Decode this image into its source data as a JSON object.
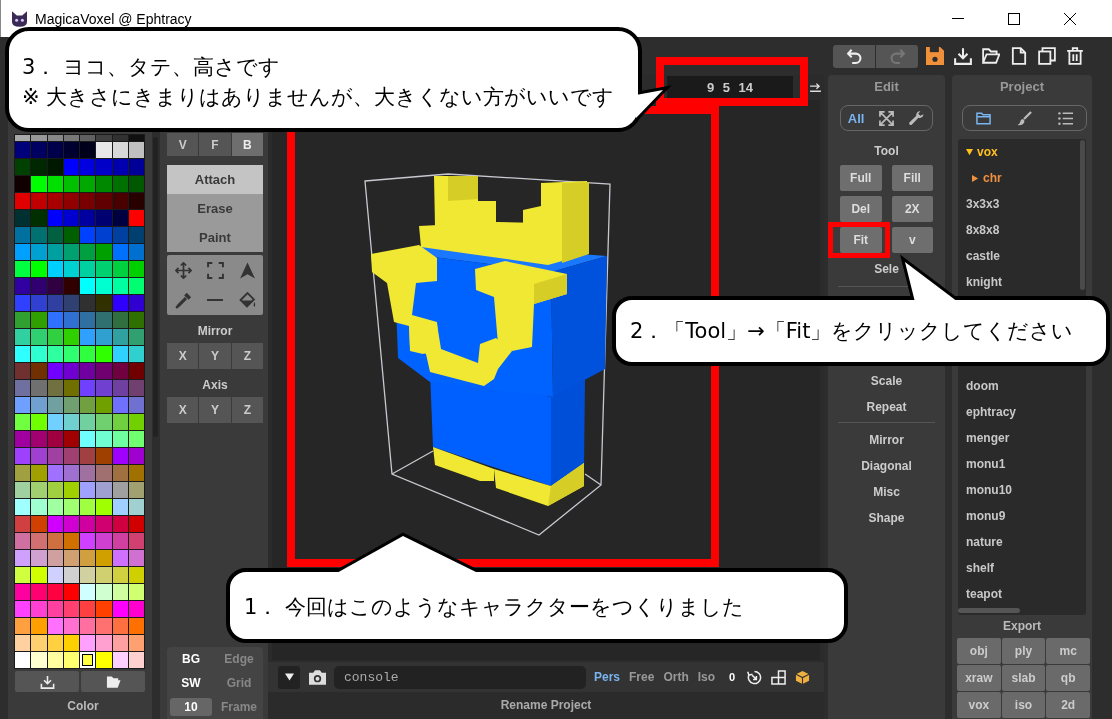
{
  "window": {
    "title": "MagicaVoxel @ Ephtracy"
  },
  "toolbar": {
    "history": [
      {
        "disabled": false
      },
      {
        "disabled": true
      }
    ]
  },
  "palette": {
    "label": "Color",
    "swatches": [
      {
        "color": "#a8a8a8",
        "selected": false
      },
      {
        "color": "#989898",
        "selected": false
      },
      {
        "color": "#888888",
        "selected": false
      },
      {
        "color": "#787878",
        "selected": false
      },
      {
        "color": "#606060",
        "selected": false
      },
      {
        "color": "#404040",
        "selected": false
      },
      {
        "color": "#303030",
        "selected": false
      },
      {
        "color": "#101010",
        "selected": false
      },
      {
        "color": "#00007a",
        "selected": false
      },
      {
        "color": "#000060",
        "selected": false
      },
      {
        "color": "#00004a",
        "selected": false
      },
      {
        "color": "#000030",
        "selected": false
      },
      {
        "color": "#00001a",
        "selected": false
      },
      {
        "color": "#e8e8e8",
        "selected": false
      },
      {
        "color": "#d8d8d8",
        "selected": false
      },
      {
        "color": "#c0c0c0",
        "selected": false
      },
      {
        "color": "#004000",
        "selected": false
      },
      {
        "color": "#002800",
        "selected": false
      },
      {
        "color": "#001800",
        "selected": false
      },
      {
        "color": "#0000ff",
        "selected": false
      },
      {
        "color": "#0000e0",
        "selected": false
      },
      {
        "color": "#0000c8",
        "selected": false
      },
      {
        "color": "#0000b0",
        "selected": false
      },
      {
        "color": "#000098",
        "selected": false
      },
      {
        "color": "#100000",
        "selected": false
      },
      {
        "color": "#00ff00",
        "selected": false
      },
      {
        "color": "#00e000",
        "selected": false
      },
      {
        "color": "#00c000",
        "selected": false
      },
      {
        "color": "#00a800",
        "selected": false
      },
      {
        "color": "#008800",
        "selected": false
      },
      {
        "color": "#007000",
        "selected": false
      },
      {
        "color": "#005800",
        "selected": false
      },
      {
        "color": "#e00000",
        "selected": false
      },
      {
        "color": "#c00000",
        "selected": false
      },
      {
        "color": "#a80000",
        "selected": false
      },
      {
        "color": "#900000",
        "selected": false
      },
      {
        "color": "#780000",
        "selected": false
      },
      {
        "color": "#600000",
        "selected": false
      },
      {
        "color": "#480000",
        "selected": false
      },
      {
        "color": "#280000",
        "selected": false
      },
      {
        "color": "#003030",
        "selected": false
      },
      {
        "color": "#003000",
        "selected": false
      },
      {
        "color": "#0000ff",
        "selected": false
      },
      {
        "color": "#0000d0",
        "selected": false
      },
      {
        "color": "#0000a0",
        "selected": false
      },
      {
        "color": "#000070",
        "selected": false
      },
      {
        "color": "#000040",
        "selected": false
      },
      {
        "color": "#ff0000",
        "selected": false
      },
      {
        "color": "#0070a0",
        "selected": false
      },
      {
        "color": "#007070",
        "selected": false
      },
      {
        "color": "#006040",
        "selected": false
      },
      {
        "color": "#006000",
        "selected": false
      },
      {
        "color": "#0040ff",
        "selected": false
      },
      {
        "color": "#0040d0",
        "selected": false
      },
      {
        "color": "#0040a0",
        "selected": false
      },
      {
        "color": "#004070",
        "selected": false
      },
      {
        "color": "#00a0ff",
        "selected": false
      },
      {
        "color": "#00a0d0",
        "selected": false
      },
      {
        "color": "#00a0a0",
        "selected": false
      },
      {
        "color": "#00a070",
        "selected": false
      },
      {
        "color": "#00a040",
        "selected": false
      },
      {
        "color": "#00a000",
        "selected": false
      },
      {
        "color": "#0070ff",
        "selected": false
      },
      {
        "color": "#0070d0",
        "selected": false
      },
      {
        "color": "#00ff40",
        "selected": false
      },
      {
        "color": "#00ff00",
        "selected": false
      },
      {
        "color": "#00d0ff",
        "selected": false
      },
      {
        "color": "#00d0d0",
        "selected": false
      },
      {
        "color": "#00d0a0",
        "selected": false
      },
      {
        "color": "#00d070",
        "selected": false
      },
      {
        "color": "#00d040",
        "selected": false
      },
      {
        "color": "#00d000",
        "selected": false
      },
      {
        "color": "#3000a0",
        "selected": false
      },
      {
        "color": "#300070",
        "selected": false
      },
      {
        "color": "#300040",
        "selected": false
      },
      {
        "color": "#300000",
        "selected": false
      },
      {
        "color": "#00ffff",
        "selected": false
      },
      {
        "color": "#00ffd0",
        "selected": false
      },
      {
        "color": "#00ffa0",
        "selected": false
      },
      {
        "color": "#00ff70",
        "selected": false
      },
      {
        "color": "#3040ff",
        "selected": false
      },
      {
        "color": "#3040d0",
        "selected": false
      },
      {
        "color": "#3040a0",
        "selected": false
      },
      {
        "color": "#304070",
        "selected": false
      },
      {
        "color": "#303030",
        "selected": false
      },
      {
        "color": "#303000",
        "selected": false
      },
      {
        "color": "#3000ff",
        "selected": false
      },
      {
        "color": "#3000d0",
        "selected": false
      },
      {
        "color": "#30a030",
        "selected": false
      },
      {
        "color": "#30a000",
        "selected": false
      },
      {
        "color": "#3070ff",
        "selected": false
      },
      {
        "color": "#3070d0",
        "selected": false
      },
      {
        "color": "#3070a0",
        "selected": false
      },
      {
        "color": "#307070",
        "selected": false
      },
      {
        "color": "#307040",
        "selected": false
      },
      {
        "color": "#307000",
        "selected": false
      },
      {
        "color": "#30d0a0",
        "selected": false
      },
      {
        "color": "#30d070",
        "selected": false
      },
      {
        "color": "#30d040",
        "selected": false
      },
      {
        "color": "#30d000",
        "selected": false
      },
      {
        "color": "#30a0ff",
        "selected": false
      },
      {
        "color": "#30a0d0",
        "selected": false
      },
      {
        "color": "#30a0a0",
        "selected": false
      },
      {
        "color": "#30a070",
        "selected": false
      },
      {
        "color": "#30ffff",
        "selected": false
      },
      {
        "color": "#30ffd0",
        "selected": false
      },
      {
        "color": "#30ffa0",
        "selected": false
      },
      {
        "color": "#30ff70",
        "selected": false
      },
      {
        "color": "#30ff40",
        "selected": false
      },
      {
        "color": "#30ff00",
        "selected": false
      },
      {
        "color": "#30d0ff",
        "selected": false
      },
      {
        "color": "#30d0d0",
        "selected": false
      },
      {
        "color": "#703030",
        "selected": false
      },
      {
        "color": "#703000",
        "selected": false
      },
      {
        "color": "#7000ff",
        "selected": false
      },
      {
        "color": "#7000d0",
        "selected": false
      },
      {
        "color": "#7000a0",
        "selected": false
      },
      {
        "color": "#700070",
        "selected": false
      },
      {
        "color": "#700040",
        "selected": false
      },
      {
        "color": "#700000",
        "selected": false
      },
      {
        "color": "#7070a0",
        "selected": false
      },
      {
        "color": "#707070",
        "selected": false
      },
      {
        "color": "#707040",
        "selected": false
      },
      {
        "color": "#707000",
        "selected": false
      },
      {
        "color": "#7040ff",
        "selected": false
      },
      {
        "color": "#7040d0",
        "selected": false
      },
      {
        "color": "#7040a0",
        "selected": false
      },
      {
        "color": "#704070",
        "selected": false
      },
      {
        "color": "#70a0ff",
        "selected": false
      },
      {
        "color": "#70a0d0",
        "selected": false
      },
      {
        "color": "#70a0a0",
        "selected": false
      },
      {
        "color": "#70a070",
        "selected": false
      },
      {
        "color": "#70a040",
        "selected": false
      },
      {
        "color": "#70a000",
        "selected": false
      },
      {
        "color": "#7070ff",
        "selected": false
      },
      {
        "color": "#7070d0",
        "selected": false
      },
      {
        "color": "#70ff40",
        "selected": false
      },
      {
        "color": "#70ff00",
        "selected": false
      },
      {
        "color": "#70d0ff",
        "selected": false
      },
      {
        "color": "#70d0d0",
        "selected": false
      },
      {
        "color": "#70d0a0",
        "selected": false
      },
      {
        "color": "#70d070",
        "selected": false
      },
      {
        "color": "#70d040",
        "selected": false
      },
      {
        "color": "#70d000",
        "selected": false
      },
      {
        "color": "#a000a0",
        "selected": false
      },
      {
        "color": "#a00070",
        "selected": false
      },
      {
        "color": "#a00040",
        "selected": false
      },
      {
        "color": "#a00000",
        "selected": false
      },
      {
        "color": "#70ffff",
        "selected": false
      },
      {
        "color": "#70ffd0",
        "selected": false
      },
      {
        "color": "#70ffa0",
        "selected": false
      },
      {
        "color": "#70ff70",
        "selected": false
      },
      {
        "color": "#a040ff",
        "selected": false
      },
      {
        "color": "#a040d0",
        "selected": false
      },
      {
        "color": "#a040a0",
        "selected": false
      },
      {
        "color": "#a04070",
        "selected": false
      },
      {
        "color": "#a04040",
        "selected": false
      },
      {
        "color": "#a04000",
        "selected": false
      },
      {
        "color": "#a000ff",
        "selected": false
      },
      {
        "color": "#a000d0",
        "selected": false
      },
      {
        "color": "#a0a040",
        "selected": false
      },
      {
        "color": "#a0a000",
        "selected": false
      },
      {
        "color": "#a070ff",
        "selected": false
      },
      {
        "color": "#a070d0",
        "selected": false
      },
      {
        "color": "#a070a0",
        "selected": false
      },
      {
        "color": "#a07070",
        "selected": false
      },
      {
        "color": "#a07040",
        "selected": false
      },
      {
        "color": "#a07000",
        "selected": false
      },
      {
        "color": "#a0d0a0",
        "selected": false
      },
      {
        "color": "#a0d070",
        "selected": false
      },
      {
        "color": "#a0d040",
        "selected": false
      },
      {
        "color": "#a0d000",
        "selected": false
      },
      {
        "color": "#a0a0ff",
        "selected": false
      },
      {
        "color": "#a0a0d0",
        "selected": false
      },
      {
        "color": "#a0a0a0",
        "selected": false
      },
      {
        "color": "#a0a070",
        "selected": false
      },
      {
        "color": "#a0ffff",
        "selected": false
      },
      {
        "color": "#a0ffd0",
        "selected": false
      },
      {
        "color": "#a0ffa0",
        "selected": false
      },
      {
        "color": "#a0ff70",
        "selected": false
      },
      {
        "color": "#a0ff40",
        "selected": false
      },
      {
        "color": "#a0ff00",
        "selected": false
      },
      {
        "color": "#a0d0ff",
        "selected": false
      },
      {
        "color": "#a0d0d0",
        "selected": false
      },
      {
        "color": "#d04040",
        "selected": false
      },
      {
        "color": "#d04000",
        "selected": false
      },
      {
        "color": "#d000ff",
        "selected": false
      },
      {
        "color": "#d000d0",
        "selected": false
      },
      {
        "color": "#d000a0",
        "selected": false
      },
      {
        "color": "#d00070",
        "selected": false
      },
      {
        "color": "#d00040",
        "selected": false
      },
      {
        "color": "#d00000",
        "selected": false
      },
      {
        "color": "#d070a0",
        "selected": false
      },
      {
        "color": "#d07070",
        "selected": false
      },
      {
        "color": "#d07040",
        "selected": false
      },
      {
        "color": "#d07000",
        "selected": false
      },
      {
        "color": "#d040ff",
        "selected": false
      },
      {
        "color": "#d040d0",
        "selected": false
      },
      {
        "color": "#d040a0",
        "selected": false
      },
      {
        "color": "#d04070",
        "selected": false
      },
      {
        "color": "#d0a0ff",
        "selected": false
      },
      {
        "color": "#d0a0d0",
        "selected": false
      },
      {
        "color": "#d0a0a0",
        "selected": false
      },
      {
        "color": "#d0a070",
        "selected": false
      },
      {
        "color": "#d0a040",
        "selected": false
      },
      {
        "color": "#d0a000",
        "selected": false
      },
      {
        "color": "#d070ff",
        "selected": false
      },
      {
        "color": "#d070d0",
        "selected": false
      },
      {
        "color": "#d0ff40",
        "selected": false
      },
      {
        "color": "#d0ff00",
        "selected": false
      },
      {
        "color": "#d0d0ff",
        "selected": false
      },
      {
        "color": "#d0d0d0",
        "selected": false
      },
      {
        "color": "#d0d0a0",
        "selected": false
      },
      {
        "color": "#d0d070",
        "selected": false
      },
      {
        "color": "#d0d040",
        "selected": false
      },
      {
        "color": "#d0d000",
        "selected": false
      },
      {
        "color": "#ff00a0",
        "selected": false
      },
      {
        "color": "#ff0070",
        "selected": false
      },
      {
        "color": "#ff0040",
        "selected": false
      },
      {
        "color": "#ff0000",
        "selected": false
      },
      {
        "color": "#d0ffff",
        "selected": false
      },
      {
        "color": "#d0ffd0",
        "selected": false
      },
      {
        "color": "#d0ffa0",
        "selected": false
      },
      {
        "color": "#d0ff70",
        "selected": false
      },
      {
        "color": "#ff40ff",
        "selected": false
      },
      {
        "color": "#ff40d0",
        "selected": false
      },
      {
        "color": "#ff40a0",
        "selected": false
      },
      {
        "color": "#ff4070",
        "selected": false
      },
      {
        "color": "#ff4040",
        "selected": false
      },
      {
        "color": "#ff4000",
        "selected": false
      },
      {
        "color": "#ff00ff",
        "selected": false
      },
      {
        "color": "#ff00d0",
        "selected": false
      },
      {
        "color": "#ffa040",
        "selected": false
      },
      {
        "color": "#ffa000",
        "selected": false
      },
      {
        "color": "#ff70ff",
        "selected": false
      },
      {
        "color": "#ff70d0",
        "selected": false
      },
      {
        "color": "#ff70a0",
        "selected": false
      },
      {
        "color": "#ff7070",
        "selected": false
      },
      {
        "color": "#ff7040",
        "selected": false
      },
      {
        "color": "#ff7000",
        "selected": false
      },
      {
        "color": "#ffd0a0",
        "selected": false
      },
      {
        "color": "#ffd070",
        "selected": false
      },
      {
        "color": "#ffd040",
        "selected": false
      },
      {
        "color": "#ffd000",
        "selected": false
      },
      {
        "color": "#ffa0ff",
        "selected": false
      },
      {
        "color": "#ffa0d0",
        "selected": false
      },
      {
        "color": "#ffa0a0",
        "selected": false
      },
      {
        "color": "#ffa070",
        "selected": false
      },
      {
        "color": "#ffffff",
        "selected": false
      },
      {
        "color": "#ffffd0",
        "selected": false
      },
      {
        "color": "#ffffa0",
        "selected": false
      },
      {
        "color": "#ffff70",
        "selected": false
      },
      {
        "color": "#ffff40",
        "selected": true
      },
      {
        "color": "#ffff00",
        "selected": false
      },
      {
        "color": "#ffd0ff",
        "selected": false
      },
      {
        "color": "#ffd0d0",
        "selected": false
      }
    ]
  },
  "tools": {
    "views": [
      {
        "label": "V",
        "selected": false
      },
      {
        "label": "F",
        "selected": false
      },
      {
        "label": "B",
        "selected": true
      }
    ],
    "modes": [
      {
        "label": "Attach",
        "selected": true
      },
      {
        "label": "Erase",
        "selected": false
      },
      {
        "label": "Paint",
        "selected": false
      }
    ],
    "mirror": {
      "label": "Mirror",
      "axes": [
        {
          "label": "X"
        },
        {
          "label": "Y"
        },
        {
          "label": "Z"
        }
      ]
    },
    "axis": {
      "label": "Axis",
      "axes": [
        {
          "label": "X"
        },
        {
          "label": "Y"
        },
        {
          "label": "Z"
        }
      ]
    }
  },
  "display": {
    "toggles": [
      {
        "label": "BG",
        "on": true
      },
      {
        "label": "Edge",
        "on": false
      },
      {
        "label": "SW",
        "on": true
      },
      {
        "label": "Grid",
        "on": false
      }
    ],
    "frame": {
      "value": "10",
      "label": "Frame"
    }
  },
  "viewport": {
    "dimensions": "9 5 14"
  },
  "bottom_bar": {
    "console": {
      "placeholder": "console"
    },
    "views": [
      {
        "label": "Pers",
        "selected": true
      },
      {
        "label": "Free",
        "selected": false
      },
      {
        "label": "Orth",
        "selected": false
      },
      {
        "label": "Iso",
        "selected": false
      }
    ],
    "count": "0",
    "caption": "Rename Project"
  },
  "edit": {
    "title": "Edit",
    "filters": [
      {
        "label": "All",
        "selected": true
      },
      {
        "selected": false
      },
      {
        "selected": false
      }
    ],
    "tool_label": "Tool",
    "tool_buttons": [
      "Full",
      "Fill",
      "Del",
      "2X",
      "Fit",
      "v"
    ],
    "commands_upper": [
      "Sele"
    ],
    "commands_lower": [
      "Scale",
      "Repeat"
    ],
    "commands_bottom": [
      "Mirror",
      "Diagonal",
      "Misc",
      "Shape"
    ]
  },
  "project": {
    "title": "Project",
    "tabs": [
      {
        "selected": true
      },
      {
        "selected": false
      },
      {
        "selected": false
      }
    ],
    "tree": [
      {
        "label": "vox",
        "expanded": true,
        "children": [
          {
            "label": "chr",
            "expanded": false
          }
        ]
      }
    ],
    "files_upper": [
      "3x3x3",
      "8x8x8",
      "castle",
      "knight"
    ],
    "files_lower": [
      "doom",
      "ephtracy",
      "menger",
      "monu1",
      "monu10",
      "monu9",
      "nature",
      "shelf",
      "teapot"
    ],
    "export": {
      "title": "Export",
      "formats": [
        "obj",
        "ply",
        "mc",
        "xraw",
        "slab",
        "qb",
        "vox",
        "iso",
        "2d"
      ]
    }
  },
  "callouts": [
    {
      "lines": [
        "3． ヨコ、タテ、高さです",
        "※ 大きさにきまりはありませんが、大きくない方がいいです"
      ]
    },
    {
      "lines": [
        "2．「Tool」→「Fit」をクリックしてください"
      ]
    },
    {
      "lines": [
        "1． 今回はこのようなキャラクターをつくりました"
      ]
    }
  ]
}
